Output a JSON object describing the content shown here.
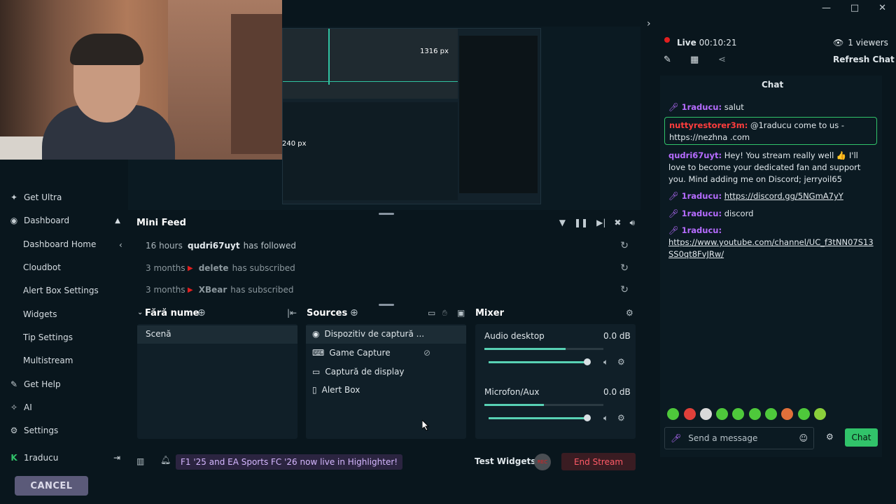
{
  "window": {
    "minimize": "—",
    "maximize": "□",
    "close": "✕"
  },
  "preview": {
    "px_width": "1316 px",
    "px_height": "240 px"
  },
  "sidebar": {
    "get_ultra": "Get Ultra",
    "dashboard": "Dashboard",
    "dashboard_home": "Dashboard Home",
    "cloudbot": "Cloudbot",
    "alert_box_settings": "Alert Box Settings",
    "widgets": "Widgets",
    "tip_settings": "Tip Settings",
    "multistream": "Multistream",
    "get_help": "Get Help",
    "ai": "AI",
    "settings": "Settings",
    "user": "1raducu",
    "cancel": "CANCEL"
  },
  "mini_feed": {
    "title": "Mini Feed",
    "items": [
      {
        "time": "16 hours",
        "user": "qudri67uyt",
        "action": "has followed"
      },
      {
        "time": "3 months",
        "user": "delete",
        "action": "has subscribed"
      },
      {
        "time": "3 months",
        "user": "XBear",
        "action": "has subscribed"
      }
    ]
  },
  "scenes": {
    "title": "Fără nume",
    "items": [
      "Scenă"
    ]
  },
  "sources": {
    "title": "Sources",
    "items": [
      "Dispozitiv de captură ...",
      "Game Capture",
      "Captură de display",
      "Alert Box"
    ]
  },
  "mixer": {
    "title": "Mixer",
    "channels": [
      {
        "name": "Audio desktop",
        "db": "0.0 dB",
        "level": 0.68
      },
      {
        "name": "Microfon/Aux",
        "db": "0.0 dB",
        "level": 0.5
      }
    ]
  },
  "bottom_bar": {
    "banner": "F1 '25 and EA Sports FC '26 now live in Highlighter!",
    "test_widgets": "Test Widgets",
    "rec": "REC",
    "end_stream": "End Stream"
  },
  "live": {
    "label": "Live",
    "time": "00:10:21",
    "viewers": "1 viewers",
    "refresh": "Refresh Chat"
  },
  "chat": {
    "title": "Chat",
    "messages": [
      {
        "user": "1raducu:",
        "text": "salut"
      },
      {
        "user": "nuttyrestorer3m:",
        "text": "@1raducu come to us - https://nezhna .com"
      },
      {
        "user": "qudri67uyt:",
        "text": "Hey! You stream really well 👍 I'll love to become your dedicated fan and support you. Mind adding me on Discord; jerryoil65"
      },
      {
        "user": "1raducu:",
        "link": "https://discord.gg/5NGmA7yY"
      },
      {
        "user": "1raducu:",
        "text": "discord"
      },
      {
        "user": "1raducu:",
        "link": "https://www.youtube.com/channel/UC_f3tNN07S13SS0qt8FvJRw/"
      }
    ],
    "input_placeholder": "Send a message",
    "send": "Chat"
  },
  "colors": {
    "accent": "#31c36a",
    "live_dot": "#e21f1f",
    "mod_purple": "#b66cff",
    "end_stream": "#ff5a67"
  }
}
